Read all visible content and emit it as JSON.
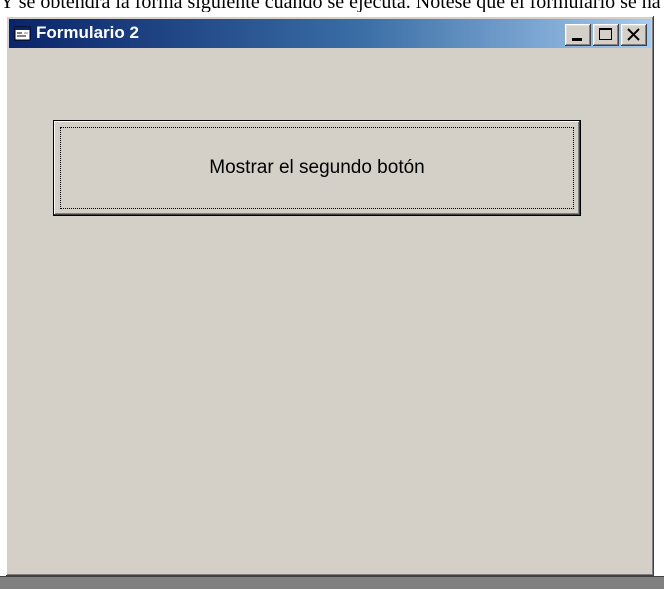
{
  "background_text": "Y se obtendrá la forma siguiente cuando se ejecuta. Nótese que el formulario se ha",
  "window": {
    "title": "Formulario 2",
    "app_icon": "form-icon",
    "controls": {
      "minimize_icon": "minimize-icon",
      "maximize_icon": "maximize-icon",
      "close_icon": "close-icon"
    }
  },
  "form": {
    "button_label": "Mostrar el segundo botón"
  },
  "colors": {
    "titlebar_start": "#0a246a",
    "titlebar_end": "#a6caf0",
    "face": "#d4d0c8",
    "text": "#000000"
  }
}
